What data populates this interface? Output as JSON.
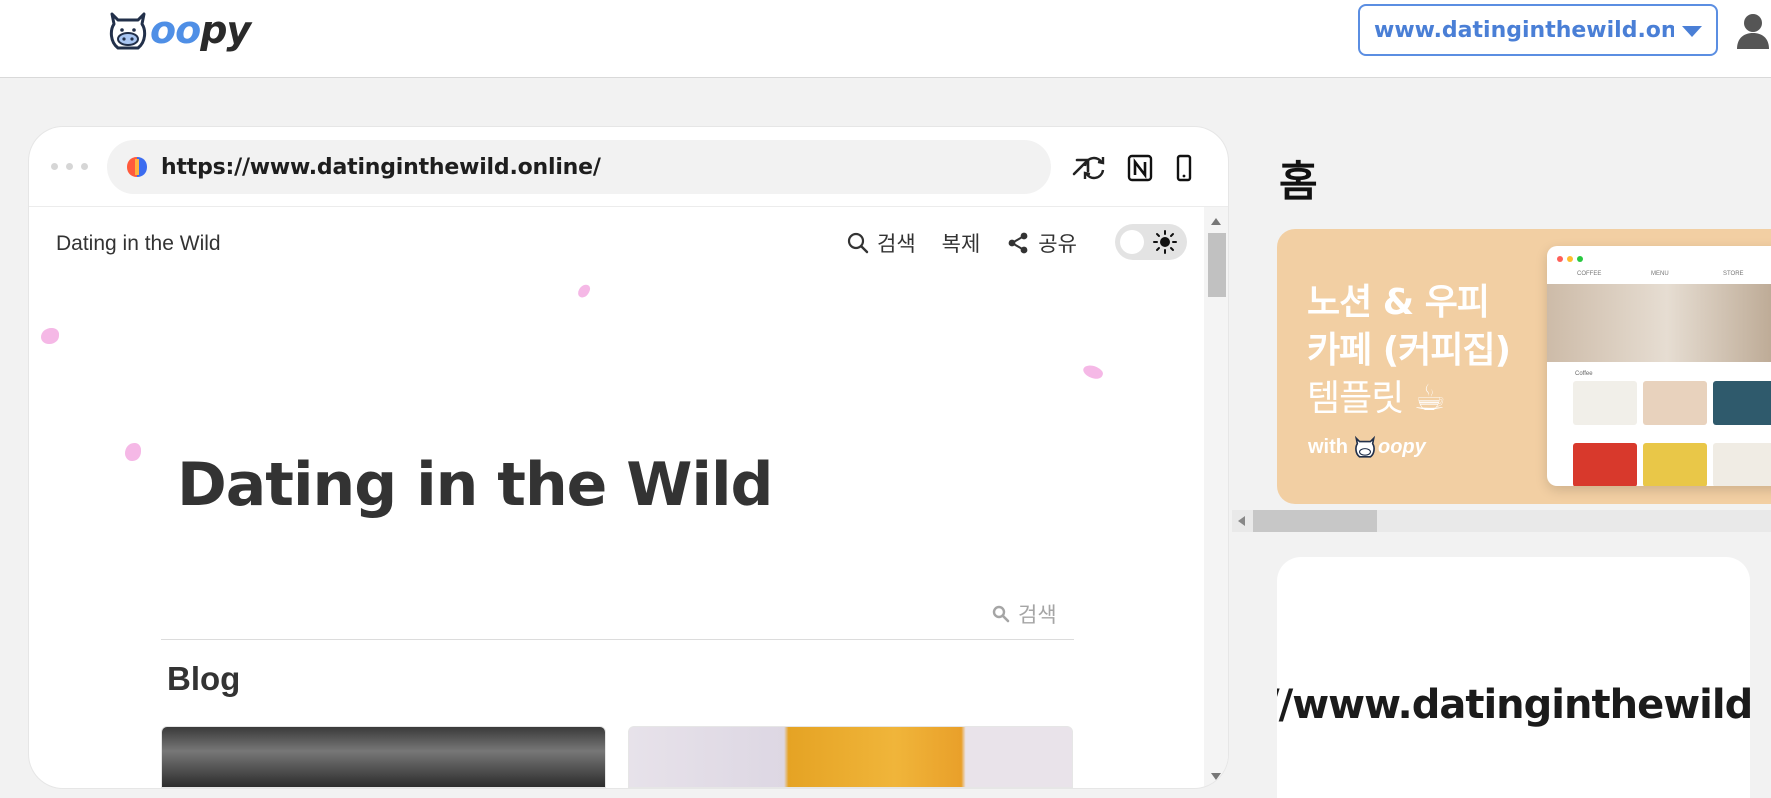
{
  "app": {
    "logo_text": "oopy",
    "site_selector": "www.datinginthewild.onli..."
  },
  "preview": {
    "url": "https://www.datinginthewild.online/",
    "page_header_title": "Dating in the Wild",
    "actions": {
      "search": "검색",
      "duplicate": "복제",
      "share": "공유"
    },
    "page_title": "Dating in the Wild",
    "db_search_label": "검색",
    "section_heading": "Blog"
  },
  "right_panel": {
    "title": "홈",
    "banner": {
      "line1": "노션 & 우피",
      "line2": "카페 (커피집)",
      "line3": "템플릿 ☕",
      "with_label": "with",
      "brand": "oopy",
      "mock_nav": [
        "COFFEE",
        "MENU",
        "STORE"
      ],
      "mock_section": "Coffee"
    },
    "info_card_url": "//www.datinginthewild."
  },
  "colors": {
    "accent": "#4a7fd6",
    "petal": "#f5b8e6",
    "banner_bg": "#f2cfa3"
  },
  "icons": [
    "cow-logo-icon",
    "chevron-down-icon",
    "user-icon",
    "favicon-icon",
    "open-external-icon",
    "refresh-icon",
    "notion-icon",
    "mobile-icon",
    "search-icon",
    "share-icon",
    "sun-icon"
  ]
}
